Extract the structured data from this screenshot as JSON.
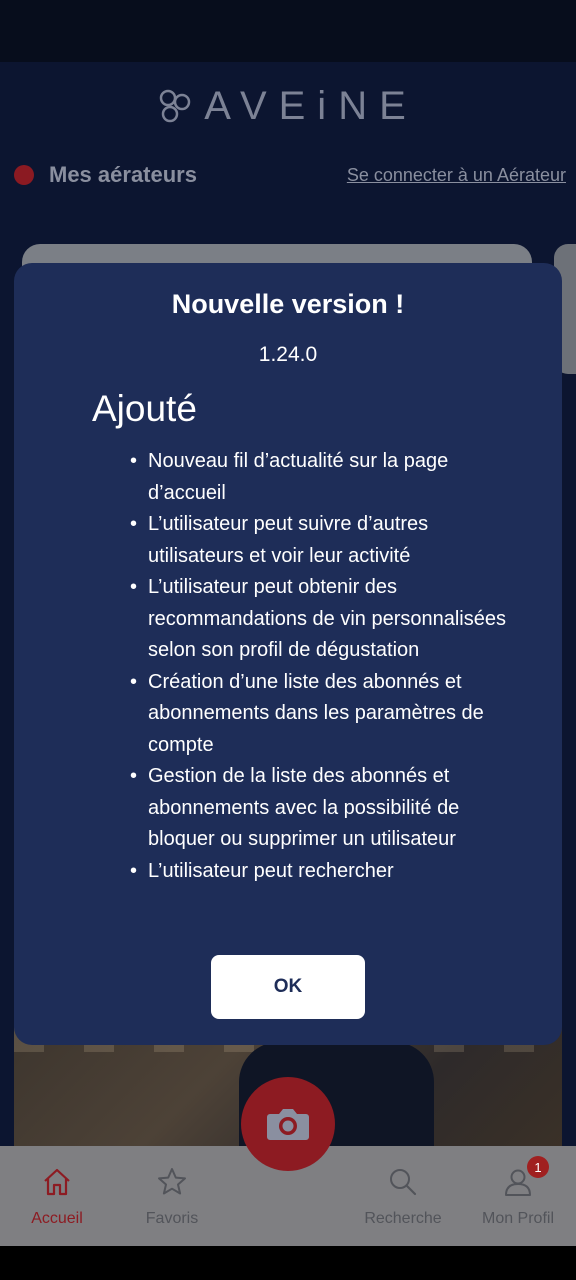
{
  "header": {
    "logo_text": "AVEiNE",
    "section_title": "Mes aérateurs",
    "connect_link": "Se connecter à un Aérateur"
  },
  "dialog": {
    "title": "Nouvelle version !",
    "version": "1.24.0",
    "section": "Ajouté",
    "items": [
      "Nouveau fil d’actualité sur la page d’accueil",
      "L’utilisateur peut suivre d’autres utilisateurs et voir leur activité",
      "L’utilisateur peut obtenir des recommandations de vin personnalisées selon son profil de dégustation",
      "Création d’une liste des abonnés et abonnements dans les paramètres de compte",
      "Gestion de la liste des abonnés et abonnements avec la possibilité de bloquer ou supprimer un utilisateur",
      "L’utilisateur peut rechercher"
    ],
    "ok_label": "OK"
  },
  "nav": {
    "items": [
      {
        "label": "Accueil",
        "icon": "home-icon",
        "active": true
      },
      {
        "label": "Favoris",
        "icon": "star-icon",
        "active": false
      },
      {
        "label": "Recherche",
        "icon": "search-icon",
        "active": false
      },
      {
        "label": "Mon Profil",
        "icon": "user-icon",
        "active": false,
        "badge": "1"
      }
    ],
    "camera_icon": "camera-icon"
  },
  "colors": {
    "app_background": "#0c1530",
    "dialog_background": "#1e2d58",
    "accent_red": "#8d1b22",
    "nav_background": "#7f7f82"
  }
}
